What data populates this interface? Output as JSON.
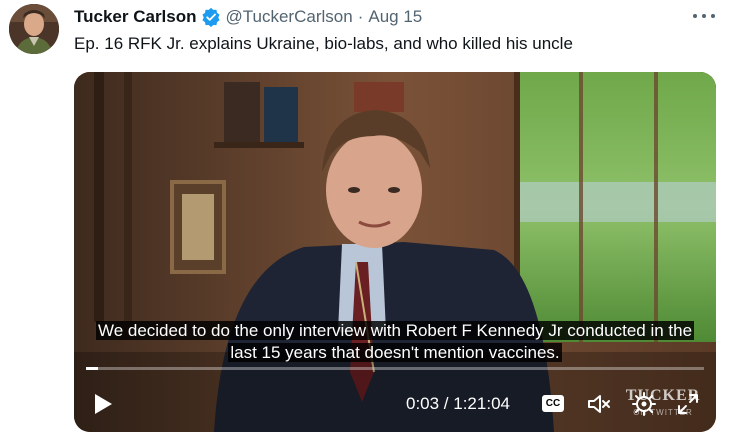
{
  "tweet": {
    "author_name": "Tucker Carlson",
    "handle": "@TuckerCarlson",
    "separator": "·",
    "date": "Aug 15",
    "text": "Ep. 16  RFK Jr. explains Ukraine, bio-labs, and who killed his uncle"
  },
  "video": {
    "subtitle_line1": "We decided to do the only interview with Robert F Kennedy Jr conducted in the",
    "subtitle_line2": "last 15 years that doesn't mention vaccines.",
    "time_display": "0:03 / 1:21:04",
    "cc_label": "CC",
    "watermark_line1": "TUCKER",
    "watermark_line2": "ON TWITTER",
    "progress_fraction": 0.0006
  },
  "colors": {
    "verified_badge": "#1d9bf0",
    "secondary_text": "#536471"
  }
}
